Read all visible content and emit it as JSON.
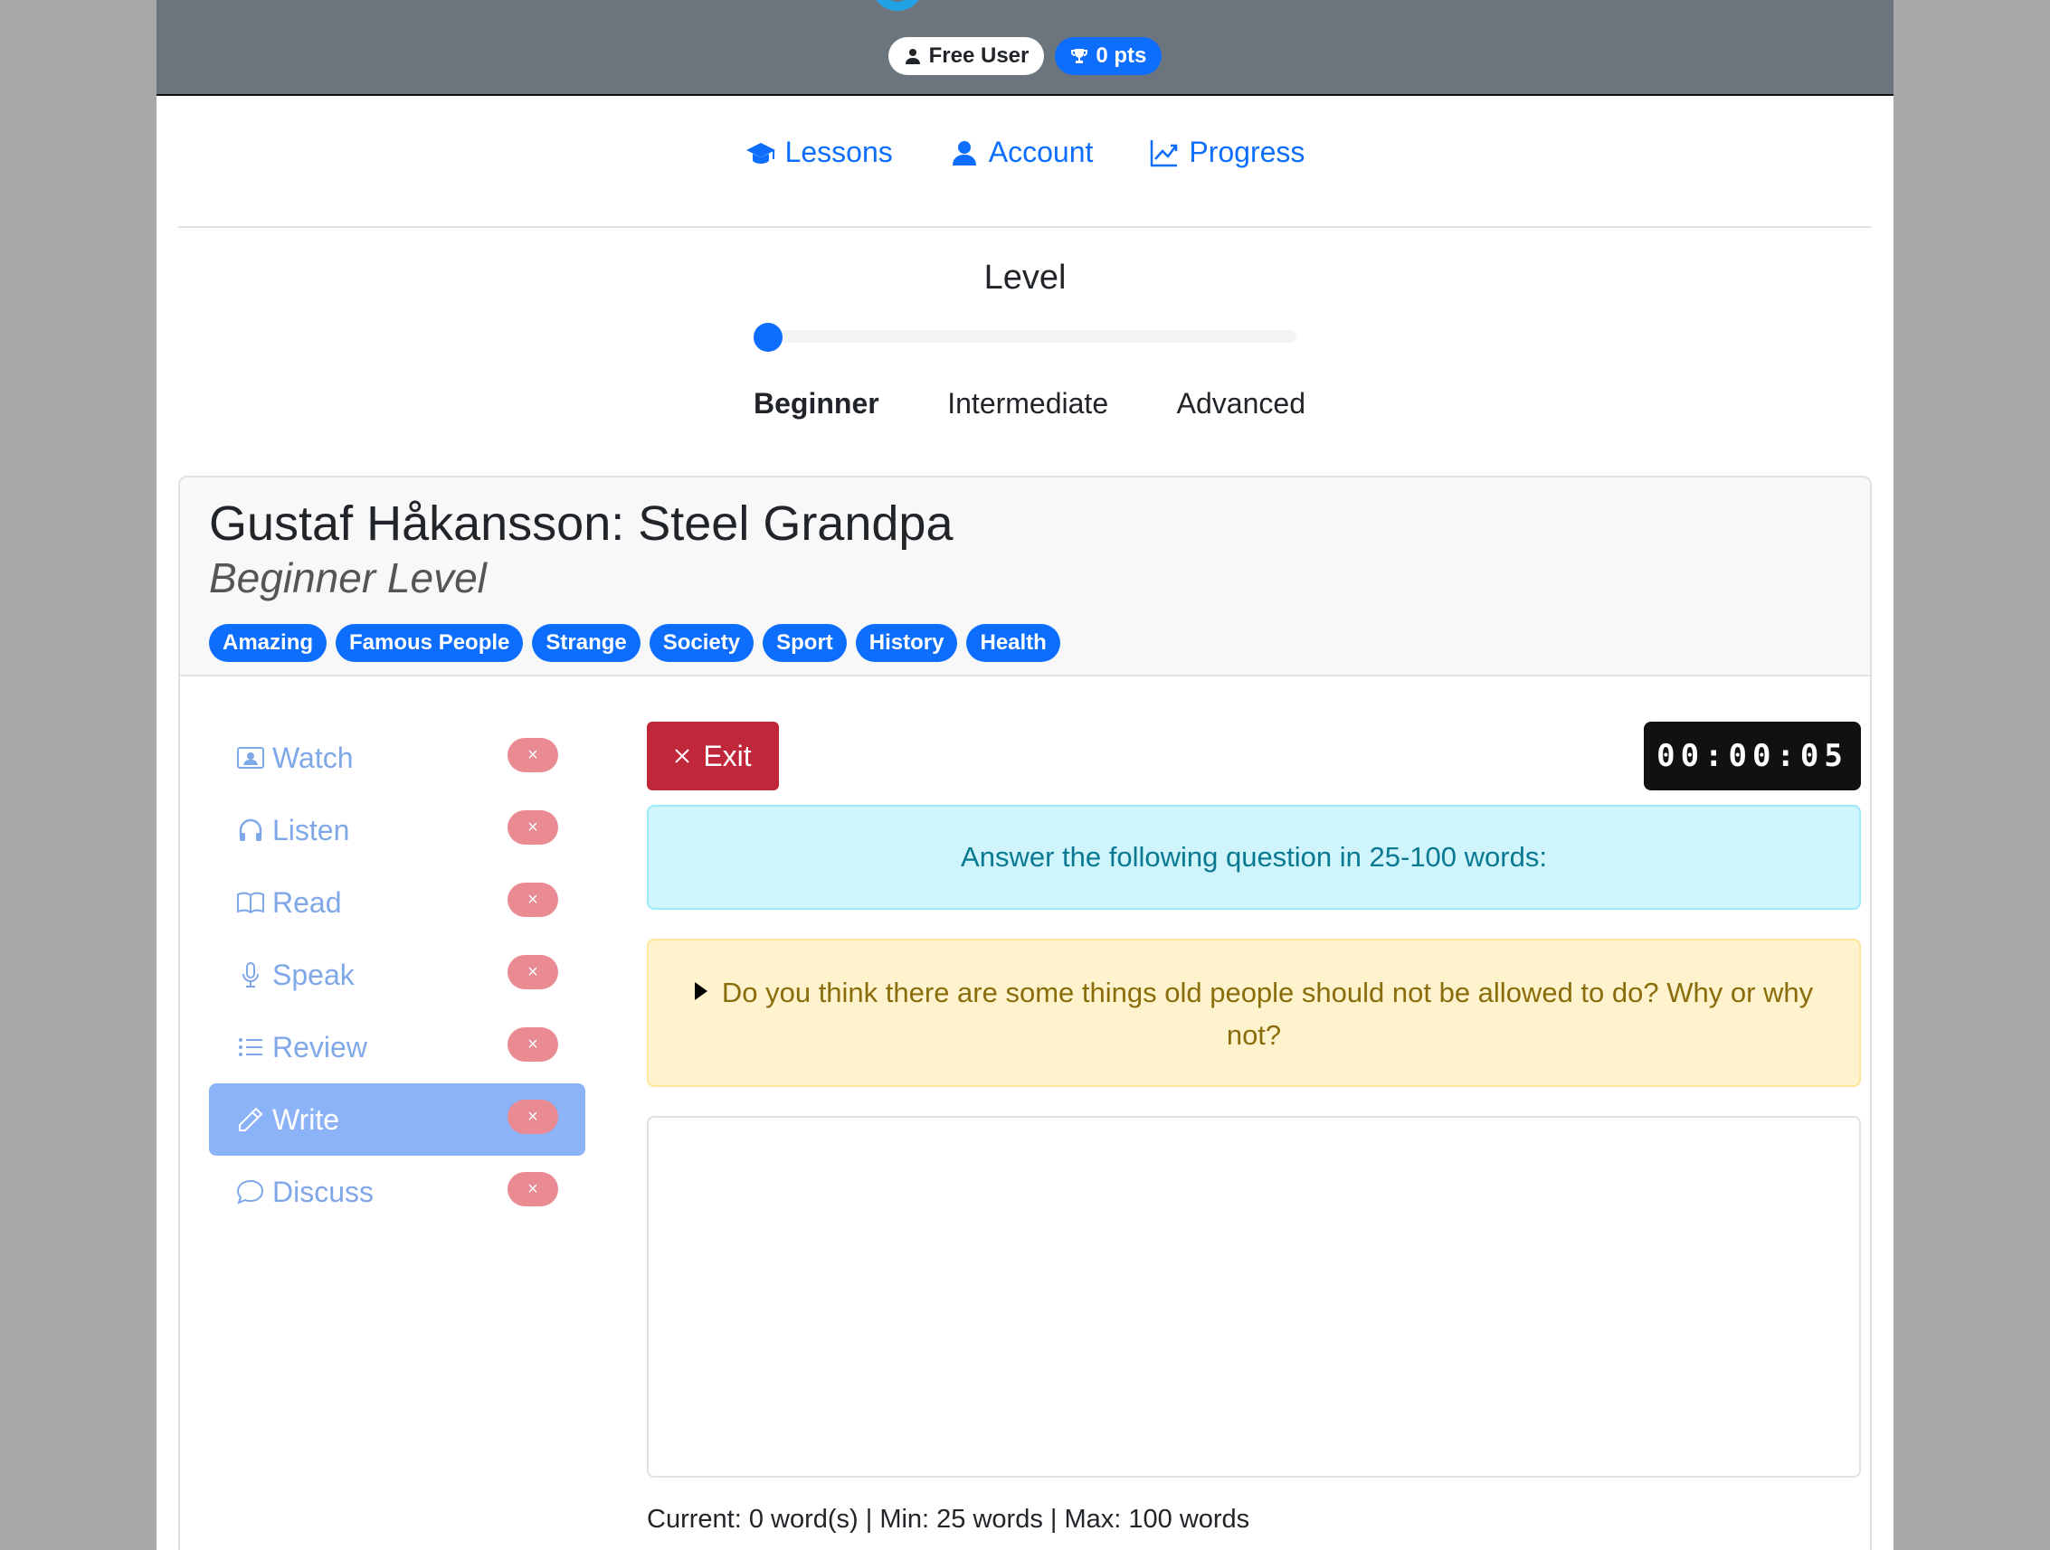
{
  "header": {
    "user_badge": "Free User",
    "points_badge": "0 pts"
  },
  "nav": [
    {
      "label": "Lessons",
      "icon": "graduation-cap-icon"
    },
    {
      "label": "Account",
      "icon": "user-icon"
    },
    {
      "label": "Progress",
      "icon": "chart-line-icon"
    }
  ],
  "level": {
    "title": "Level",
    "options": [
      "Beginner",
      "Intermediate",
      "Advanced"
    ],
    "selected": "Beginner"
  },
  "lesson": {
    "title": "Gustaf Håkansson: Steel Grandpa",
    "subtitle": "Beginner Level",
    "tags": [
      "Amazing",
      "Famous People",
      "Strange",
      "Society",
      "Sport",
      "History",
      "Health"
    ]
  },
  "sidebar": {
    "items": [
      {
        "label": "Watch",
        "icon": "video-icon"
      },
      {
        "label": "Listen",
        "icon": "headphones-icon"
      },
      {
        "label": "Read",
        "icon": "book-icon"
      },
      {
        "label": "Speak",
        "icon": "microphone-icon"
      },
      {
        "label": "Review",
        "icon": "list-icon"
      },
      {
        "label": "Write",
        "icon": "pencil-icon"
      },
      {
        "label": "Discuss",
        "icon": "chat-icon"
      }
    ],
    "active": "Write",
    "status_mark": "×"
  },
  "activity": {
    "exit_label": "Exit",
    "timer": "00:00:05",
    "instruction": "Answer the following question in 25-100 words:",
    "question": "Do you think there are some things old people should not be allowed to do? Why or why not?",
    "answer_value": "",
    "word_count": "Current: 0 word(s) | Min: 25 words | Max: 100 words"
  },
  "colors": {
    "primary": "#0d6efd",
    "danger": "#c0273a",
    "topbar": "#6c757d",
    "info_bg": "#cff4fc",
    "warning_bg": "#fff3cd"
  }
}
